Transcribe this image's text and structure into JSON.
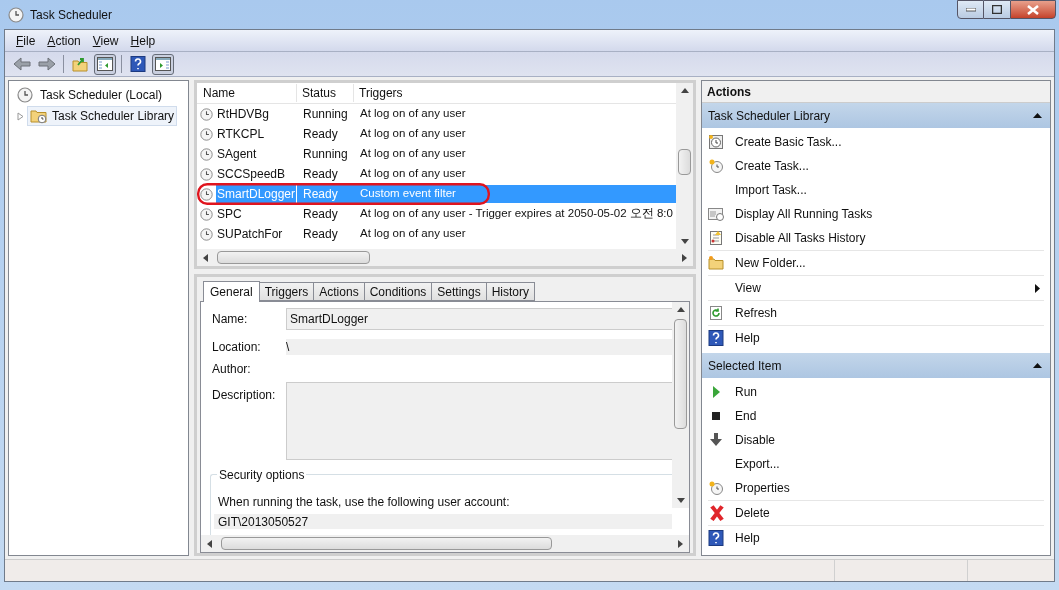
{
  "window": {
    "title": "Task Scheduler"
  },
  "menu": [
    {
      "label": "File"
    },
    {
      "label": "Action"
    },
    {
      "label": "View"
    },
    {
      "label": "Help"
    }
  ],
  "toolbar": [
    {
      "kind": "back",
      "pressed": false
    },
    {
      "kind": "forward",
      "pressed": false
    },
    {
      "kind": "separator"
    },
    {
      "kind": "up",
      "pressed": false
    },
    {
      "kind": "tree",
      "pressed": true
    },
    {
      "kind": "separator"
    },
    {
      "kind": "help",
      "pressed": false
    },
    {
      "kind": "actions",
      "pressed": true
    }
  ],
  "tree": {
    "label": "Task Scheduler (Local)",
    "selected": false,
    "children": [
      {
        "label": "Task Scheduler Library",
        "selected": true,
        "expanded": false
      }
    ]
  },
  "task_list": {
    "columns": [
      "Name",
      "Status",
      "Triggers"
    ],
    "rows": [
      {
        "name": "RtHDVBg",
        "status": "Running",
        "triggers": "At log on of any user",
        "selected": false
      },
      {
        "name": "RTKCPL",
        "status": "Ready",
        "triggers": "At log on of any user",
        "selected": false
      },
      {
        "name": "SAgent",
        "status": "Running",
        "triggers": "At log on of any user",
        "selected": false
      },
      {
        "name": "SCCSpeedB",
        "status": "Ready",
        "triggers": "At log on of any user",
        "selected": false
      },
      {
        "name": "SmartDLogger",
        "status": "Ready",
        "triggers": "Custom event filter",
        "selected": true
      },
      {
        "name": "SPC",
        "status": "Ready",
        "triggers": "At log on of any user - Trigger expires at 2050-05-02 오전 8:0",
        "selected": false
      },
      {
        "name": "SUPatchFor",
        "status": "Ready",
        "triggers": "At log on of any user",
        "selected": false
      }
    ]
  },
  "tabs": [
    {
      "label": "General",
      "selected": true
    },
    {
      "label": "Triggers",
      "selected": false
    },
    {
      "label": "Actions",
      "selected": false
    },
    {
      "label": "Conditions",
      "selected": false
    },
    {
      "label": "Settings",
      "selected": false
    },
    {
      "label": "History",
      "selected": false
    }
  ],
  "general": {
    "name_label": "Name:",
    "name": "SmartDLogger",
    "location_label": "Location:",
    "location": "\\",
    "author_label": "Author:",
    "description_label": "Description:",
    "security_title": "Security options",
    "account_prompt": "When running the task, use the following user account:",
    "account": "GIT\\2013050527"
  },
  "actions_pane": {
    "title": "Actions",
    "sections": [
      {
        "title": "Task Scheduler Library",
        "expanded": true,
        "groups": [
          [
            {
              "label": "Create Basic Task...",
              "kind": "basic-task",
              "submenu": false
            },
            {
              "label": "Create Task...",
              "kind": "task",
              "submenu": false
            },
            {
              "label": "Import Task...",
              "kind": "plain",
              "submenu": false
            },
            {
              "label": "Display All Running Tasks",
              "kind": "running",
              "submenu": false
            },
            {
              "label": "Disable All Tasks History",
              "kind": "history",
              "submenu": false
            }
          ],
          [
            {
              "label": "New Folder...",
              "kind": "folder",
              "submenu": false
            }
          ],
          [
            {
              "label": "View",
              "kind": "plain",
              "submenu": true
            }
          ],
          [
            {
              "label": "Refresh",
              "kind": "refresh",
              "submenu": false
            }
          ],
          [
            {
              "label": "Help",
              "kind": "help",
              "submenu": false
            }
          ]
        ]
      },
      {
        "title": "Selected Item",
        "expanded": true,
        "groups": [
          [
            {
              "label": "Run",
              "kind": "run",
              "submenu": false
            },
            {
              "label": "End",
              "kind": "end",
              "submenu": false
            },
            {
              "label": "Disable",
              "kind": "disable",
              "submenu": false
            },
            {
              "label": "Export...",
              "kind": "plain",
              "submenu": false
            },
            {
              "label": "Properties",
              "kind": "task",
              "submenu": false
            }
          ],
          [
            {
              "label": "Delete",
              "kind": "delete",
              "submenu": false
            }
          ],
          [
            {
              "label": "Help",
              "kind": "help",
              "submenu": false
            }
          ]
        ]
      }
    ]
  }
}
